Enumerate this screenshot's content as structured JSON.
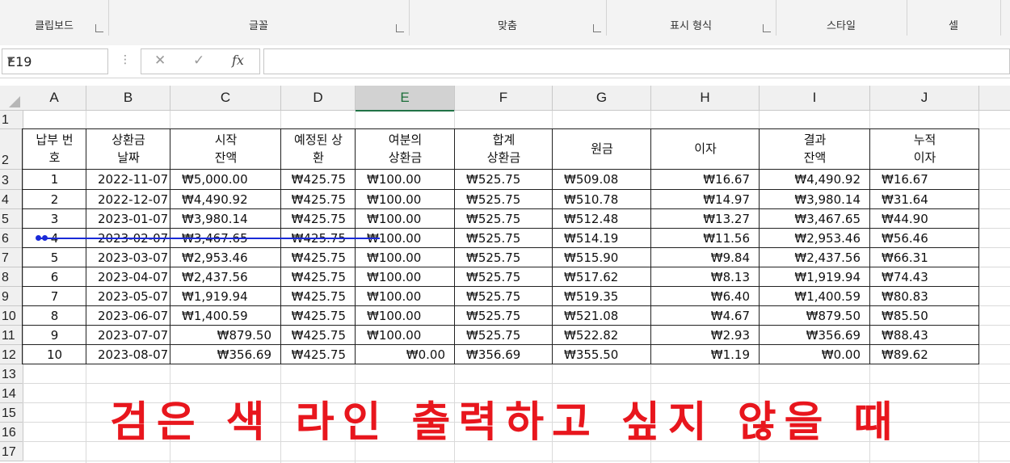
{
  "ribbon": {
    "groups": [
      "클립보드",
      "글꼴",
      "맞춤",
      "표시 형식",
      "스타일",
      "셀"
    ]
  },
  "formula_bar": {
    "name_box": "E19",
    "cancel_icon": "✕",
    "enter_icon": "✓",
    "fx_label": "fx",
    "formula": ""
  },
  "columns": [
    "A",
    "B",
    "C",
    "D",
    "E",
    "F",
    "G",
    "H",
    "I",
    "J"
  ],
  "rows": [
    "1",
    "2",
    "3",
    "4",
    "5",
    "6",
    "7",
    "8",
    "9",
    "10",
    "11",
    "12",
    "13",
    "14",
    "15",
    "16",
    "17"
  ],
  "table": {
    "headers": [
      [
        "납부 번",
        "호"
      ],
      [
        "상환금",
        "날짜"
      ],
      [
        "시작",
        "잔액"
      ],
      [
        "예정된 상",
        "환"
      ],
      [
        "여분의",
        "상환금"
      ],
      [
        "합계",
        "상환금"
      ],
      [
        "원금",
        ""
      ],
      [
        "이자",
        ""
      ],
      [
        "결과",
        "잔액"
      ],
      [
        "누적",
        "이자"
      ]
    ],
    "rows": [
      [
        "1",
        "2022-11-07",
        "₩5,000.00",
        "₩425.75",
        "₩100.00",
        "₩525.75",
        "₩509.08",
        "₩16.67",
        "₩4,490.92",
        "₩16.67"
      ],
      [
        "2",
        "2022-12-07",
        "₩4,490.92",
        "₩425.75",
        "₩100.00",
        "₩525.75",
        "₩510.78",
        "₩14.97",
        "₩3,980.14",
        "₩31.64"
      ],
      [
        "3",
        "2023-01-07",
        "₩3,980.14",
        "₩425.75",
        "₩100.00",
        "₩525.75",
        "₩512.48",
        "₩13.27",
        "₩3,467.65",
        "₩44.90"
      ],
      [
        "4",
        "2023-02-07",
        "₩3,467.65",
        "₩425.75",
        "₩100.00",
        "₩525.75",
        "₩514.19",
        "₩11.56",
        "₩2,953.46",
        "₩56.46"
      ],
      [
        "5",
        "2023-03-07",
        "₩2,953.46",
        "₩425.75",
        "₩100.00",
        "₩525.75",
        "₩515.90",
        "₩9.84",
        "₩2,437.56",
        "₩66.31"
      ],
      [
        "6",
        "2023-04-07",
        "₩2,437.56",
        "₩425.75",
        "₩100.00",
        "₩525.75",
        "₩517.62",
        "₩8.13",
        "₩1,919.94",
        "₩74.43"
      ],
      [
        "7",
        "2023-05-07",
        "₩1,919.94",
        "₩425.75",
        "₩100.00",
        "₩525.75",
        "₩519.35",
        "₩6.40",
        "₩1,400.59",
        "₩80.83"
      ],
      [
        "8",
        "2023-06-07",
        "₩1,400.59",
        "₩425.75",
        "₩100.00",
        "₩525.75",
        "₩521.08",
        "₩4.67",
        "₩879.50",
        "₩85.50"
      ],
      [
        "9",
        "2023-07-07",
        "₩879.50",
        "₩425.75",
        "₩100.00",
        "₩525.75",
        "₩522.82",
        "₩2.93",
        "₩356.69",
        "₩88.43"
      ],
      [
        "10",
        "2023-08-07",
        "₩356.69",
        "₩425.75",
        "₩0.00",
        "₩356.69",
        "₩355.50",
        "₩1.19",
        "₩0.00",
        "₩89.62"
      ]
    ]
  },
  "caption": "검은 색 라인 출력하고 싶지 않을 때",
  "colors": {
    "caption": "#e8161d",
    "annotation_line": "#1a2ad8",
    "selected_column_accent": "#217346"
  },
  "selected_column": "E"
}
